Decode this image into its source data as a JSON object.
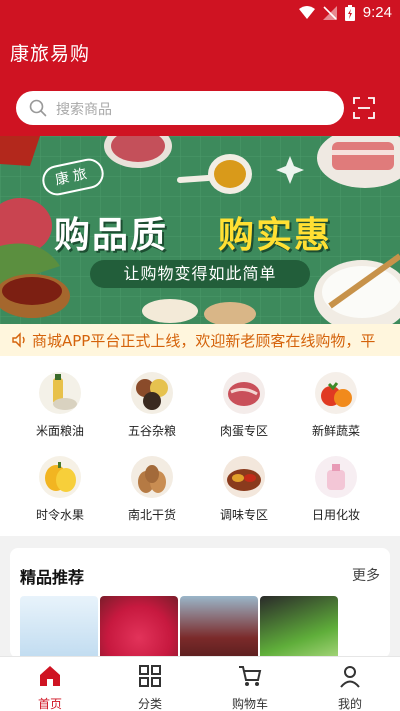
{
  "status_bar": {
    "time": "9:24"
  },
  "app": {
    "title": "康旅易购"
  },
  "search": {
    "placeholder": "搜索商品"
  },
  "banner": {
    "badge": "康旅",
    "headline_left": "购品质",
    "headline_right": "购实惠",
    "subtitle": "让购物变得如此简单"
  },
  "notice": {
    "text": "商城APP平台正式上线，欢迎新老顾客在线购物，平"
  },
  "categories": [
    {
      "label": "米面粮油",
      "icon": "grain-oil-icon"
    },
    {
      "label": "五谷杂粮",
      "icon": "cereals-icon"
    },
    {
      "label": "肉蛋专区",
      "icon": "meat-egg-icon"
    },
    {
      "label": "新鲜蔬菜",
      "icon": "vegetables-icon"
    },
    {
      "label": "时令水果",
      "icon": "fruit-icon"
    },
    {
      "label": "南北干货",
      "icon": "dried-goods-icon"
    },
    {
      "label": "调味专区",
      "icon": "seasoning-icon"
    },
    {
      "label": "日用化妆",
      "icon": "cosmetics-icon"
    }
  ],
  "recommend": {
    "title": "精品推荐",
    "more": "更多"
  },
  "tabs": [
    {
      "label": "首页",
      "icon": "home-icon",
      "active": true
    },
    {
      "label": "分类",
      "icon": "category-grid-icon",
      "active": false
    },
    {
      "label": "购物车",
      "icon": "cart-icon",
      "active": false
    },
    {
      "label": "我的",
      "icon": "profile-icon",
      "active": false
    }
  ],
  "colors": {
    "brand_red": "#cf1322",
    "notice_text": "#d4620a",
    "banner_green": "#3d8a5c",
    "accent_yellow": "#ffe033"
  }
}
